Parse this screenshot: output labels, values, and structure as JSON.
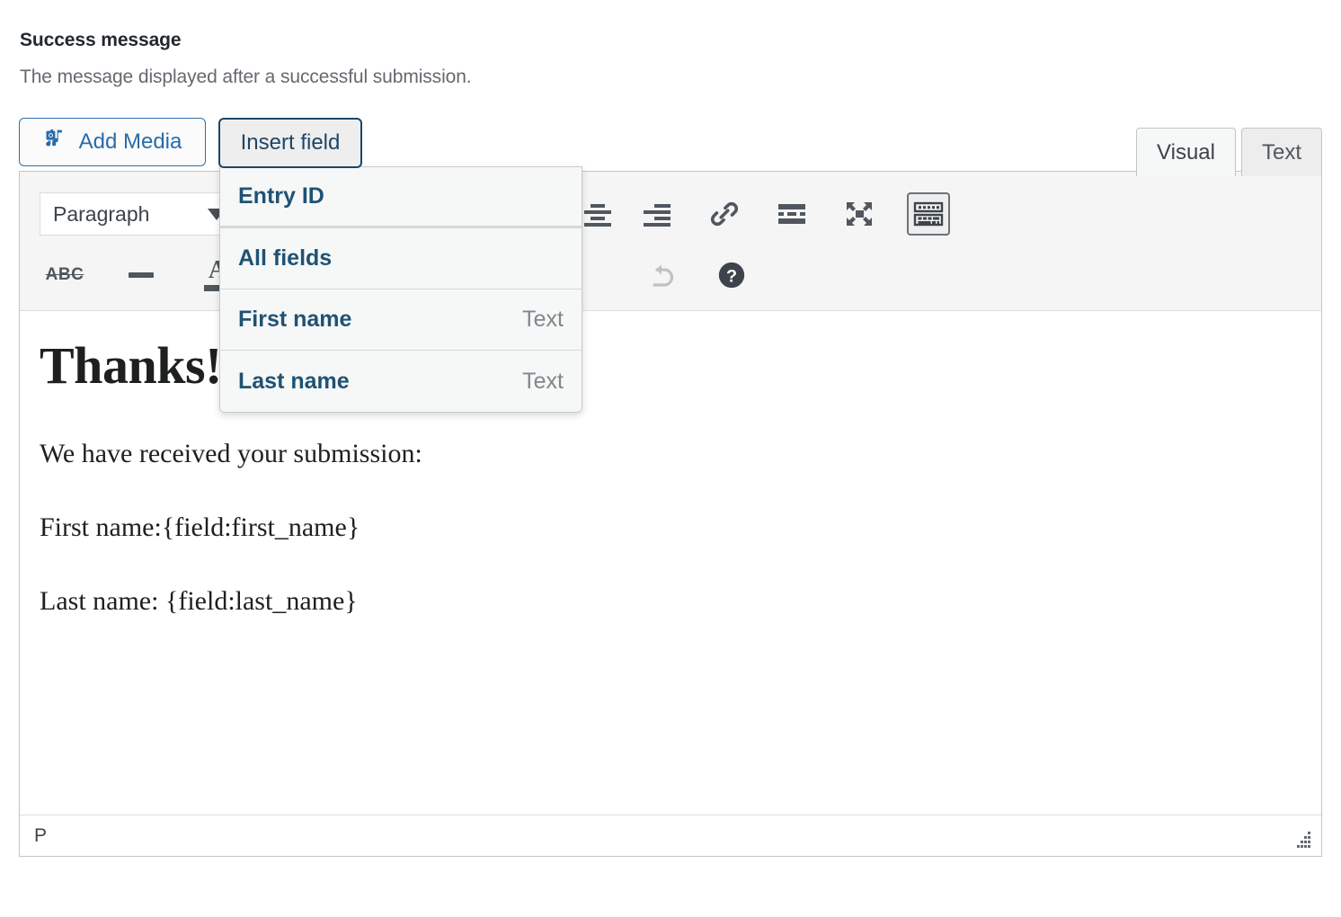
{
  "section": {
    "title": "Success message",
    "description": "The message displayed after a successful submission."
  },
  "toolbar_buttons": {
    "add_media": "Add Media",
    "add_media_icon": "camera-music-icon",
    "insert_field": "Insert field"
  },
  "editor_tabs": [
    {
      "label": "Visual",
      "active": true
    },
    {
      "label": "Text",
      "active": false
    }
  ],
  "mce": {
    "style_select_value": "Paragraph",
    "row1_icons": [
      "align-center-icon",
      "align-right-icon",
      "link-icon",
      "read-more-icon",
      "distraction-free-icon",
      "toolbar-toggle-icon"
    ],
    "row2_icons": [
      "strikethrough-icon",
      "horizontal-rule-icon",
      "text-color-icon",
      "text-color-dropdown-icon",
      "redo-icon",
      "help-icon"
    ],
    "strikethrough_label": "ABC",
    "toolbar_toggle_active": true
  },
  "content": {
    "heading": "Thanks!",
    "paragraphs": [
      "We have received your submission:",
      "First name:{field:first_name}",
      "Last name: {field:last_name}"
    ]
  },
  "status_bar": {
    "path": "P",
    "resize_handle": "resize-grip-icon"
  },
  "insert_field_menu": [
    {
      "label": "Entry ID",
      "type": "",
      "group_end": true
    },
    {
      "label": "All fields",
      "type": "",
      "group_end": false
    },
    {
      "label": "First name",
      "type": "Text",
      "group_end": false
    },
    {
      "label": "Last name",
      "type": "Text",
      "group_end": false
    }
  ],
  "colors": {
    "link_blue": "#2a6ca8",
    "menu_blue": "#1f5274",
    "icon_gray": "#50575e",
    "muted_text": "#646970"
  }
}
